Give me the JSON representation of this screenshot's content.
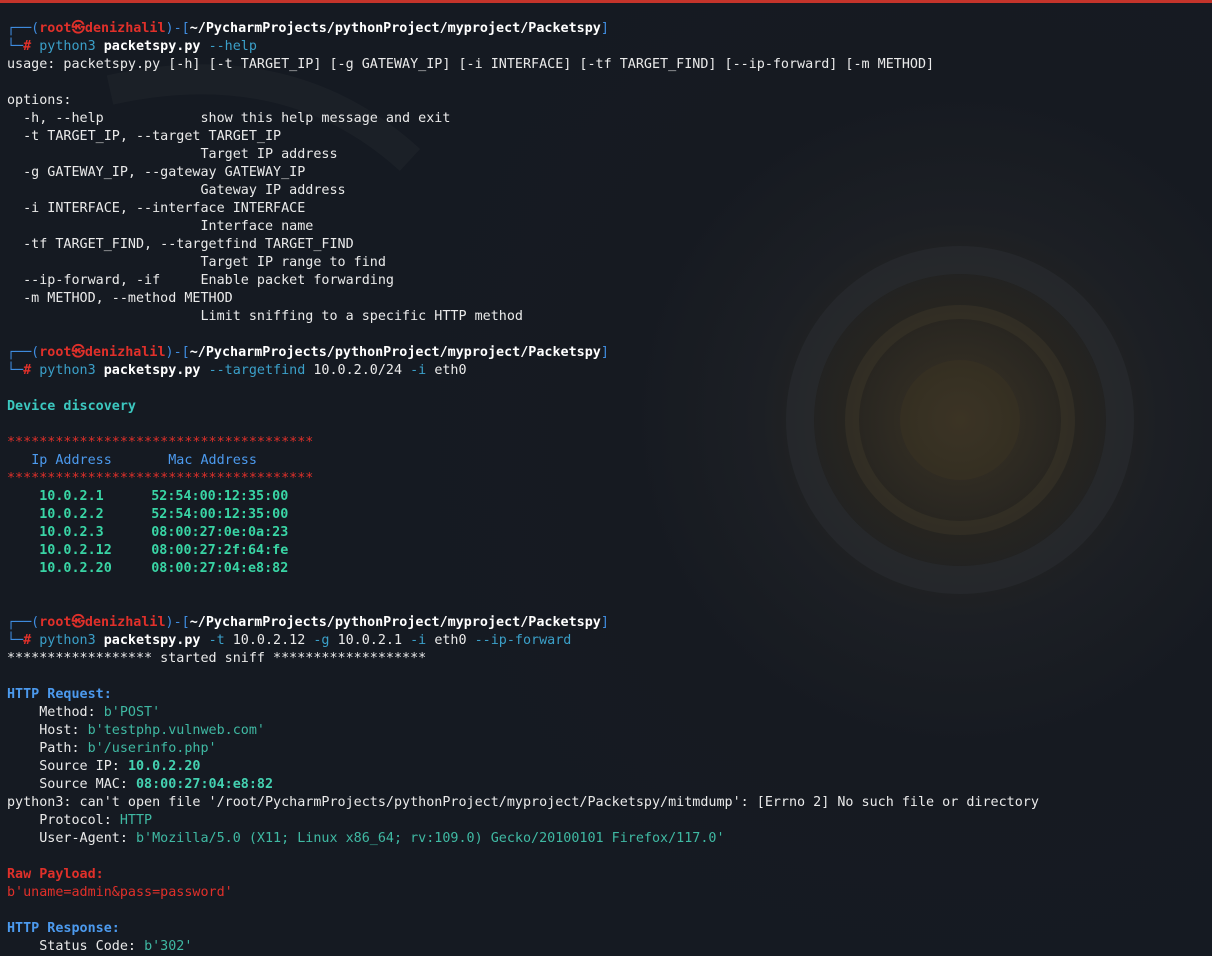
{
  "prompt": {
    "open": "┌──(",
    "user": "root",
    "at": "㉿",
    "host": "denizhalil",
    "sep": ")-[",
    "cwd": "~/PycharmProjects/pythonProject/myproject/Packetspy",
    "close": "]",
    "second_prefix": "└─",
    "hash": "#"
  },
  "cmd1": {
    "interp": "python3",
    "script": "packetspy.py",
    "args": "--help"
  },
  "help": {
    "usage": "usage: packetspy.py [-h] [-t TARGET_IP] [-g GATEWAY_IP] [-i INTERFACE] [-tf TARGET_FIND] [--ip-forward] [-m METHOD]",
    "options_header": "options:",
    "option_lines": [
      "  -h, --help            show this help message and exit",
      "  -t TARGET_IP, --target TARGET_IP",
      "                        Target IP address",
      "  -g GATEWAY_IP, --gateway GATEWAY_IP",
      "                        Gateway IP address",
      "  -i INTERFACE, --interface INTERFACE",
      "                        Interface name",
      "  -tf TARGET_FIND, --targetfind TARGET_FIND",
      "                        Target IP range to find",
      "  --ip-forward, -if     Enable packet forwarding",
      "  -m METHOD, --method METHOD",
      "                        Limit sniffing to a specific HTTP method"
    ]
  },
  "cmd2": {
    "interp": "python3",
    "script": "packetspy.py",
    "opt1": "--targetfind",
    "val1": "10.0.2.0/24",
    "opt2": "-i",
    "val2": "eth0"
  },
  "discovery": {
    "title": "Device discovery",
    "stars": "**************************************",
    "col_ip": "Ip Address",
    "col_mac": "Mac Address",
    "devices": [
      {
        "ip": "10.0.2.1",
        "mac": "52:54:00:12:35:00"
      },
      {
        "ip": "10.0.2.2",
        "mac": "52:54:00:12:35:00"
      },
      {
        "ip": "10.0.2.3",
        "mac": "08:00:27:0e:0a:23"
      },
      {
        "ip": "10.0.2.12",
        "mac": "08:00:27:2f:64:fe"
      },
      {
        "ip": "10.0.2.20",
        "mac": "08:00:27:04:e8:82"
      }
    ]
  },
  "cmd3": {
    "interp": "python3",
    "script": "packetspy.py",
    "opt1": "-t",
    "val1": "10.0.2.12",
    "opt2": "-g",
    "val2": "10.0.2.1",
    "opt3": "-i",
    "val3": "eth0",
    "opt4": "--ip-forward"
  },
  "sniff": {
    "banner": "****************** started sniff *******************",
    "request_header": "HTTP Request:",
    "method_label": "    Method: ",
    "method_value": "b'POST'",
    "host_label": "    Host: ",
    "host_value": "b'testphp.vulnweb.com'",
    "path_label": "    Path: ",
    "path_value": "b'/userinfo.php'",
    "srcip_label": "    Source IP: ",
    "srcip_value": "10.0.2.20",
    "srcmac_label": "    Source MAC: ",
    "srcmac_value": "08:00:27:04:e8:82",
    "error": "python3: can't open file '/root/PycharmProjects/pythonProject/myproject/Packetspy/mitmdump': [Errno 2] No such file or directory",
    "protocol_label": "    Protocol: ",
    "protocol_value": "HTTP",
    "ua_label": "    User-Agent: ",
    "ua_value": "b'Mozilla/5.0 (X11; Linux x86_64; rv:109.0) Gecko/20100101 Firefox/117.0'",
    "payload_header": "Raw Payload:",
    "payload_value": "b'uname=admin&pass=password'",
    "response_header": "HTTP Response:",
    "status_label": "    Status Code: ",
    "status_value": "b'302'"
  },
  "colors": {
    "background": "#151a22",
    "prompt_frame": "#3f8de0",
    "prompt_user": "#e0302a",
    "command": "#3ba0c9",
    "header": "#4c9aee",
    "ip": "#39d5a5",
    "error_red": "#e0302a"
  }
}
